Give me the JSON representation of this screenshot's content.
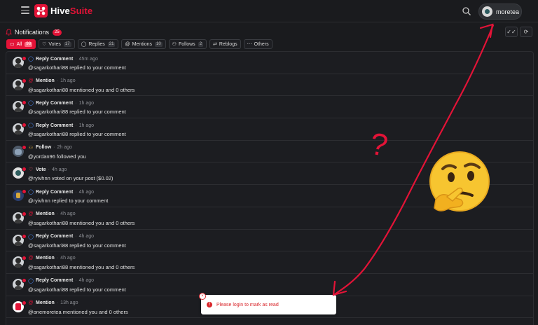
{
  "app": {
    "brand_main": "Hive",
    "brand_accent": "Suite",
    "username": "moretea",
    "accent_color": "#e31337"
  },
  "header": {
    "title": "Notifications",
    "count": "25"
  },
  "tabs": [
    {
      "label": "All",
      "count": "98",
      "icon": "inbox-icon",
      "active": true
    },
    {
      "label": "Votes",
      "count": "17",
      "icon": "heart-icon"
    },
    {
      "label": "Replies",
      "count": "21",
      "icon": "chat-bubble-icon"
    },
    {
      "label": "Mentions",
      "count": "10",
      "icon": "at-icon"
    },
    {
      "label": "Follows",
      "count": "2",
      "icon": "user-plus-icon"
    },
    {
      "label": "Reblogs",
      "count": "",
      "icon": "repeat-icon"
    },
    {
      "label": "Others",
      "count": "",
      "icon": "more-icon"
    }
  ],
  "notifications": [
    {
      "type": "Reply Comment",
      "time": "45m ago",
      "message": "@sagarkothari88 replied to your comment"
    },
    {
      "type": "Mention",
      "time": "1h ago",
      "message": "@sagarkothari88 mentioned you and 0 others"
    },
    {
      "type": "Reply Comment",
      "time": "1h ago",
      "message": "@sagarkothari88 replied to your comment"
    },
    {
      "type": "Reply Comment",
      "time": "1h ago",
      "message": "@sagarkothari88 replied to your comment"
    },
    {
      "type": "Follow",
      "time": "2h ago",
      "message": "@yordan96 followed you"
    },
    {
      "type": "Vote",
      "time": "4h ago",
      "message": "@ryivhnn voted on your post ($0.02)"
    },
    {
      "type": "Reply Comment",
      "time": "4h ago",
      "message": "@ryivhnn replied to your comment"
    },
    {
      "type": "Mention",
      "time": "4h ago",
      "message": "@sagarkothari88 mentioned you and 0 others"
    },
    {
      "type": "Reply Comment",
      "time": "4h ago",
      "message": "@sagarkothari88 replied to your comment"
    },
    {
      "type": "Mention",
      "time": "4h ago",
      "message": "@sagarkothari88 mentioned you and 0 others"
    },
    {
      "type": "Reply Comment",
      "time": "4h ago",
      "message": "@sagarkothari88 replied to your comment"
    },
    {
      "type": "Mention",
      "time": "13h ago",
      "message": "@onemoretea mentioned you and 0 others"
    }
  ],
  "toast": {
    "message": "Please login to mark as read"
  },
  "annotation": {
    "text": "?"
  }
}
